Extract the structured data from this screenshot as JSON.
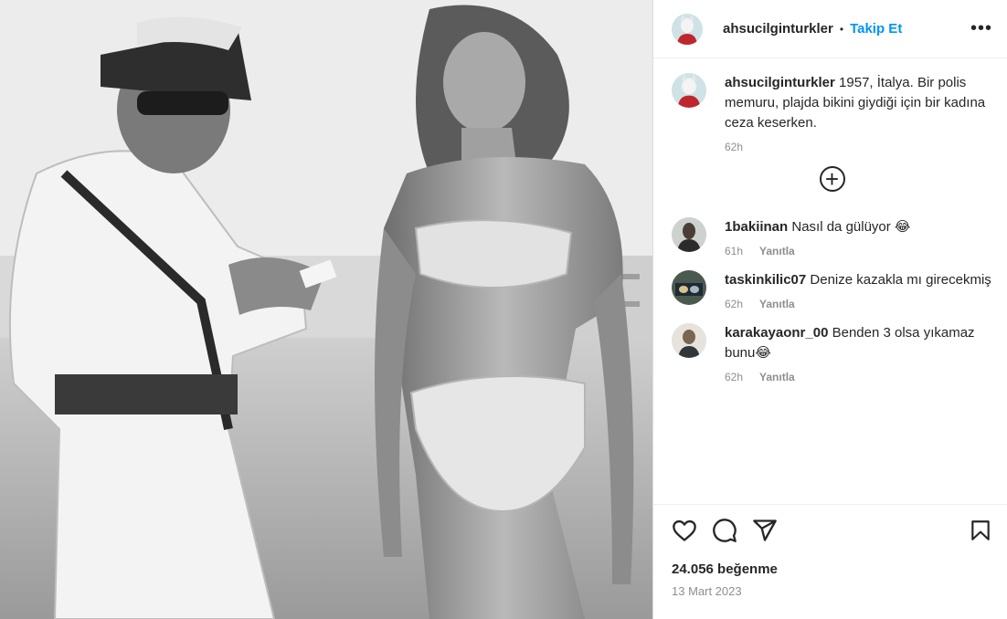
{
  "post": {
    "username": "ahsucilginturkler",
    "separator": "•",
    "follow_label": "Takip Et",
    "more_label": "•••"
  },
  "caption": {
    "username": "ahsucilginturkler",
    "text": "1957, İtalya. Bir polis memuru, plajda bikini giydiği için bir kadına ceza keserken.",
    "time": "62h"
  },
  "load_more_label": "+",
  "comments": [
    {
      "username": "1bakiinan",
      "text": "Nasıl da gülüyor 😂",
      "time": "61h",
      "reply_label": "Yanıtla"
    },
    {
      "username": "taskinkilic07",
      "text": "Denize kazakla mı girecekmiş",
      "time": "62h",
      "reply_label": "Yanıtla"
    },
    {
      "username": "karakayaonr_00",
      "text": "Benden 3 olsa yıkamaz bunu😂",
      "time": "62h",
      "reply_label": "Yanıtla"
    }
  ],
  "footer": {
    "likes": "24.056 beğenme",
    "date": "13 Mart 2023"
  },
  "icons": {
    "like": "heart-icon",
    "comment": "comment-icon",
    "share": "share-icon",
    "save": "bookmark-icon"
  }
}
